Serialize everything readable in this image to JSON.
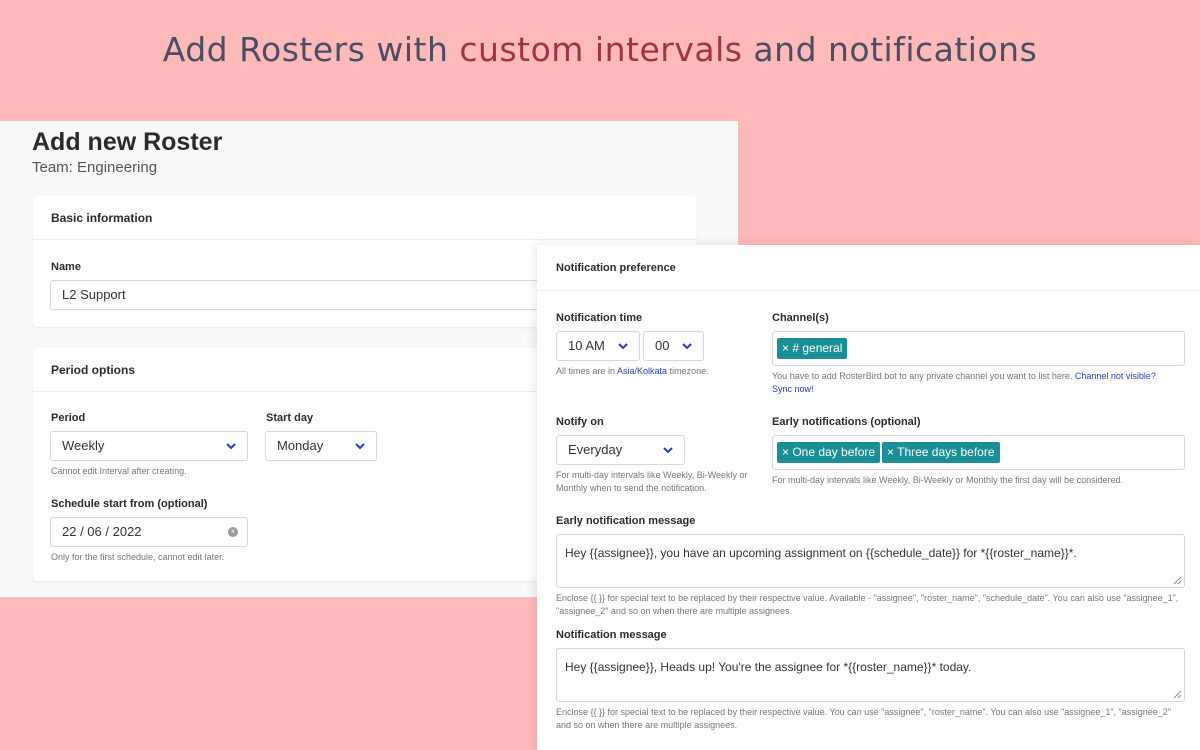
{
  "headline": {
    "part1": "Add Rosters with ",
    "accent": "custom intervals",
    "part2": " and notifications"
  },
  "page": {
    "title": "Add new Roster",
    "subtitle": "Team: Engineering"
  },
  "basic_info": {
    "heading": "Basic information",
    "name_label": "Name",
    "name_value": "L2 Support"
  },
  "period_options": {
    "heading": "Period options",
    "period_label": "Period",
    "period_value": "Weekly",
    "period_help": "Cannot edit Interval after creating.",
    "start_day_label": "Start day",
    "start_day_value": "Monday",
    "schedule_label": "Schedule start from (optional)",
    "schedule_value": "22 / 06 / 2022",
    "schedule_help": "Only for the first schedule, cannot edit later."
  },
  "notification": {
    "heading": "Notification preference",
    "time_label": "Notification time",
    "hour_value": "10 AM",
    "minute_value": "00",
    "time_help_prefix": "All times are in ",
    "time_help_zone": "Asia/Kolkata",
    "time_help_suffix": " timezone.",
    "channels_label": "Channel(s)",
    "channel_tag": "× # general",
    "channels_help": "You have to add RosterBird bot to any private channel you want to list here. ",
    "channels_help_link": "Channel not visible? Sync now!",
    "notify_on_label": "Notify on",
    "notify_on_value": "Everyday",
    "notify_on_help": "For multi-day intervals like Weekly, Bi-Weekly or Monthly when to send the notification.",
    "early_label": "Early notifications (optional)",
    "early_tags": [
      "× One day before",
      "× Three days before"
    ],
    "early_help": "For multi-day intervals like Weekly, Bi-Weekly or Monthly the first day will be considered.",
    "early_msg_label": "Early notification message",
    "early_msg_value": "Hey {{assignee}}, you have an upcoming assignment on {{schedule_date}} for *{{roster_name}}*.",
    "early_msg_help": "Enclose {{ }} for special text to be replaced by their respective value. Available - \"assignee\", \"roster_name\", \"schedule_date\". You can also use \"assignee_1\", \"assignee_2\" and so on when there are multiple assignees.",
    "msg_label": "Notification message",
    "msg_value": "Hey {{assignee}}, Heads up! You're the assignee for *{{roster_name}}* today.",
    "msg_help": "Enclose {{ }} for special text to be replaced by their respective value. You can use \"assignee\", \"roster_name\". You can also use \"assignee_1\", \"assignee_2\" and so on when there are multiple assignees."
  },
  "colors": {
    "background": "#ffb9b9",
    "accent": "#a0353f",
    "tag": "#1a8f97",
    "link": "#2b3bc7"
  }
}
